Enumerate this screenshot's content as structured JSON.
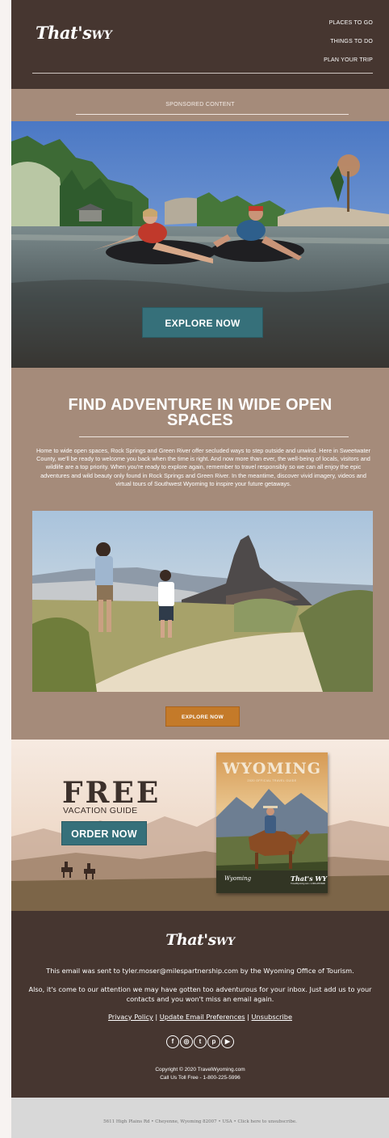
{
  "header": {
    "logo_main": "That's",
    "logo_suffix": "WY",
    "nav": [
      "PLACES TO GO",
      "THINGS TO DO",
      "PLAN YOUR TRIP"
    ]
  },
  "sponsored": {
    "label": "SPONSORED CONTENT"
  },
  "hero": {
    "button_label": "EXPLORE NOW"
  },
  "intro": {
    "title": "FIND ADVENTURE IN WIDE OPEN SPACES",
    "body": "Home to wide open spaces, Rock Springs and Green River offer secluded ways to step outside and unwind. Here in Sweetwater County, we'll be ready to welcome you back when the time is right. And now more than ever, the well-being of locals, visitors and wildlife are a top priority. When you're ready to explore again, remember to travel responsibly so we can all enjoy the epic adventures and wild beauty only found in Rock Springs and Green River. In the meantime, discover vivid imagery, videos and virtual tours of Southwest Wyoming to inspire your future getaways.",
    "button_label": "EXPLORE NOW"
  },
  "guide": {
    "free": "FREE",
    "subtitle": "VACATION GUIDE",
    "button_label": "ORDER NOW",
    "cover_title": "WYOMING",
    "cover_subtitle": "2020 OFFICIAL TRAVEL GUIDE",
    "cover_logo_left": "Wyoming",
    "cover_logo_right": "That's WY",
    "cover_url": "TravelWyoming.com • 1-800-225-5996"
  },
  "footer": {
    "logo_main": "That's",
    "logo_suffix": "WY",
    "notice": "This email was sent to tyler.moser@milespartnership.com by the Wyoming Office of Tourism.",
    "notice2": "Also, it's come to our attention we may have gotten too adventurous for your inbox. Just add us to your contacts and you won't miss an email again.",
    "links": {
      "privacy": "Privacy Policy",
      "preferences": "Update Email Preferences",
      "unsubscribe": "Unsubscribe",
      "separator": "|"
    },
    "social": [
      {
        "icon": "facebook-icon",
        "glyph": "f"
      },
      {
        "icon": "instagram-icon",
        "glyph": "◎"
      },
      {
        "icon": "twitter-icon",
        "glyph": "t"
      },
      {
        "icon": "pinterest-icon",
        "glyph": "p"
      },
      {
        "icon": "youtube-icon",
        "glyph": "▶"
      }
    ],
    "copyright": "Copyright © 2020 TravelWyoming.com",
    "phone": "Call Us Toll Free - 1-800-225-5996"
  },
  "legal": {
    "address": "5611 High Plains Rd • Cheyenne, Wyoming 82007 • USA • Click here to unsubscribe."
  },
  "colors": {
    "brown_dark": "#463630",
    "tan": "#a58b7a",
    "teal": "#36707a",
    "orange": "#c47a29"
  }
}
